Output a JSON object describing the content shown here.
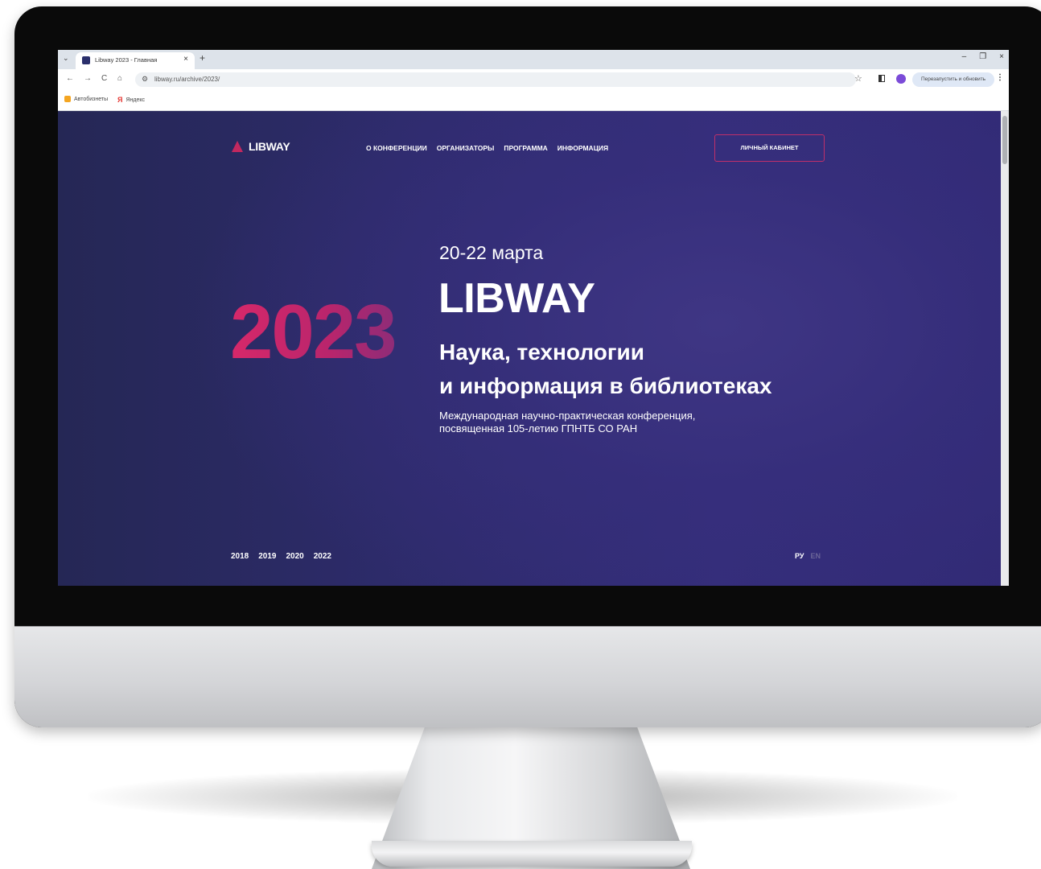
{
  "browser": {
    "tab_title": "Libway 2023 - Главная",
    "tab_close": "×",
    "new_tab": "+",
    "url": "libway.ru/archive/2023/",
    "update_button": "Перезапустить и обновить",
    "bookmarks": [
      "Автобизнеты",
      "Яндекс"
    ],
    "window_controls": [
      "–",
      "❐",
      "×"
    ]
  },
  "page": {
    "logo": "LIBWAY",
    "nav": [
      "О КОНФЕРЕНЦИИ",
      "ОРГАНИЗАТОРЫ",
      "ПРОГРАММА",
      "ИНФОРМАЦИЯ"
    ],
    "account_button": "ЛИЧНЫЙ КАБИНЕТ",
    "dates": "20-22 марта",
    "title": "LIBWAY",
    "year": "2023",
    "subtitle_line1": "Наука, технологии",
    "subtitle_line2": "и информация в библиотеках",
    "description_line1": "Международная научно-практическая конференция,",
    "description_line2": "посвященная 105-летию ГПНТБ СО РАН",
    "archive_years": [
      "2018",
      "2019",
      "2020",
      "2022"
    ],
    "languages": [
      "РУ",
      "EN"
    ],
    "active_language": "РУ"
  },
  "colors": {
    "accent": "#c2285f",
    "background_dark": "#252755",
    "background_mid": "#3f3684"
  }
}
